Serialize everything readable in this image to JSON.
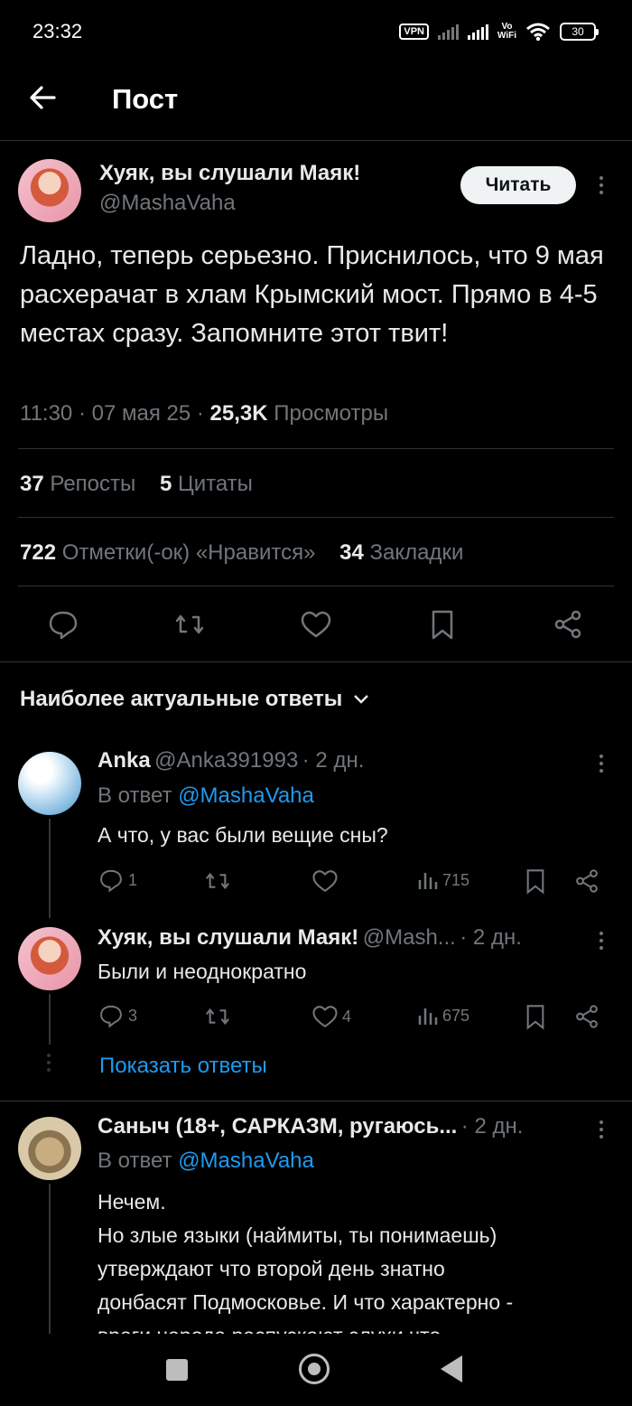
{
  "status_bar": {
    "time": "23:32",
    "vpn": "VPN",
    "volte": "Vo\nWiFi",
    "battery": "30"
  },
  "header": {
    "title": "Пост"
  },
  "post": {
    "author_name": "Хуяк, вы слушали Маяк!",
    "author_handle": "@MashaVaha",
    "follow_label": "Читать",
    "text": "Ладно, теперь серьезно. Приснилось, что 9 мая расхерачат в хлам Крымский мост. Прямо в 4-5 местах сразу. Запомните этот твит!",
    "time": "11:30",
    "date": "07 мая 25",
    "views_count": "25,3K",
    "views_label": "Просмотры",
    "reposts_count": "37",
    "reposts_label": "Репосты",
    "quotes_count": "5",
    "quotes_label": "Цитаты",
    "likes_count": "722",
    "likes_label": "Отметки(-ок) «Нравится»",
    "bookmarks_count": "34",
    "bookmarks_label": "Закладки"
  },
  "replies_header": {
    "label": "Наиболее актуальные ответы"
  },
  "replies": [
    {
      "name": "Anka",
      "handle": "@Anka391993",
      "time": "2 дн.",
      "reply_to_prefix": "В ответ",
      "reply_to": "@MashaVaha",
      "text": "А что, у вас были вещие сны?",
      "comments": "1",
      "views": "715"
    },
    {
      "name": "Хуяк, вы слушали Маяк!",
      "handle": "@Mash...",
      "time": "2 дн.",
      "text": "Были и неоднократно",
      "comments": "3",
      "likes": "4",
      "views": "675",
      "show_replies": "Показать ответы"
    },
    {
      "name": "Саныч (18+, САРКАЗМ, ругаюсь...",
      "time": "2 дн.",
      "reply_to_prefix": "В ответ",
      "reply_to": "@MashaVaha",
      "text_lines": [
        "Нечем.",
        "Но злые языки (наймиты, ты понимаешь)",
        "утверждают что второй день знатно",
        "донбасят Подмосковье. И что характерно -",
        "враги народа распускают слухи что"
      ]
    }
  ],
  "colors": {
    "background": "#000000",
    "accent": "#1d9bf0",
    "muted": "#71767b",
    "text": "#e7e9ea"
  }
}
